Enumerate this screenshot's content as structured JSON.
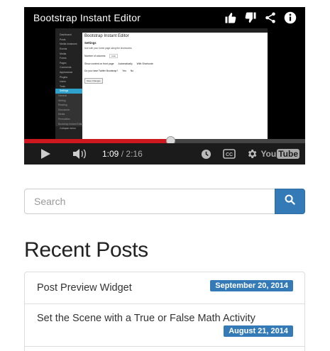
{
  "video": {
    "title": "Bootstrap Instant Editor",
    "current_time": "1:09",
    "separator": "/",
    "duration": "2:16",
    "progress": 0.52,
    "icons": [
      "thumbs-up-icon",
      "thumbs-down-icon",
      "share-icon",
      "info-icon",
      "play-icon",
      "volume-icon",
      "clock-icon",
      "captions-icon",
      "settings-gear-icon",
      "youtube-logo"
    ],
    "logo": {
      "you": "You",
      "tube": "Tube"
    },
    "embedded": {
      "menu": [
        "Dashboard",
        "Posts",
        "Media Instances",
        "Events",
        "Media",
        "Forms",
        "Pages",
        "Comments",
        "Appearance",
        "Plugins",
        "Users",
        "Tools",
        "Settings",
        "General",
        "Writing",
        "Reading",
        "Discussion",
        "Media",
        "Permalinks",
        "Bootstrap Instant Editor",
        "Collapse menu"
      ],
      "heading": "Bootstrap Instant Editor",
      "section": "Settings",
      "desc": "Use with your home page using the shortcodes.",
      "row1_label": "Number of columns",
      "row1_value": "Icon",
      "row2_label": "Show content on front page",
      "row2_opt1": "Automatically",
      "row2_opt2": "With Shortcode",
      "row3_label": "Do you have Twitter Bootstrap?",
      "row3_opt1": "Yes",
      "row3_opt2": "No",
      "save": "Save Changes"
    }
  },
  "search": {
    "placeholder": "Search",
    "button_icon": "search-icon"
  },
  "recent_posts": {
    "title": "Recent Posts",
    "items": [
      {
        "title": "Post Preview Widget",
        "date": "September 20, 2014"
      },
      {
        "title": "Set the Scene with a True or False Math Activity",
        "date": "August 21, 2014"
      }
    ]
  },
  "colors": {
    "primary": "#337ab7",
    "progress_played": "#cc181e"
  }
}
